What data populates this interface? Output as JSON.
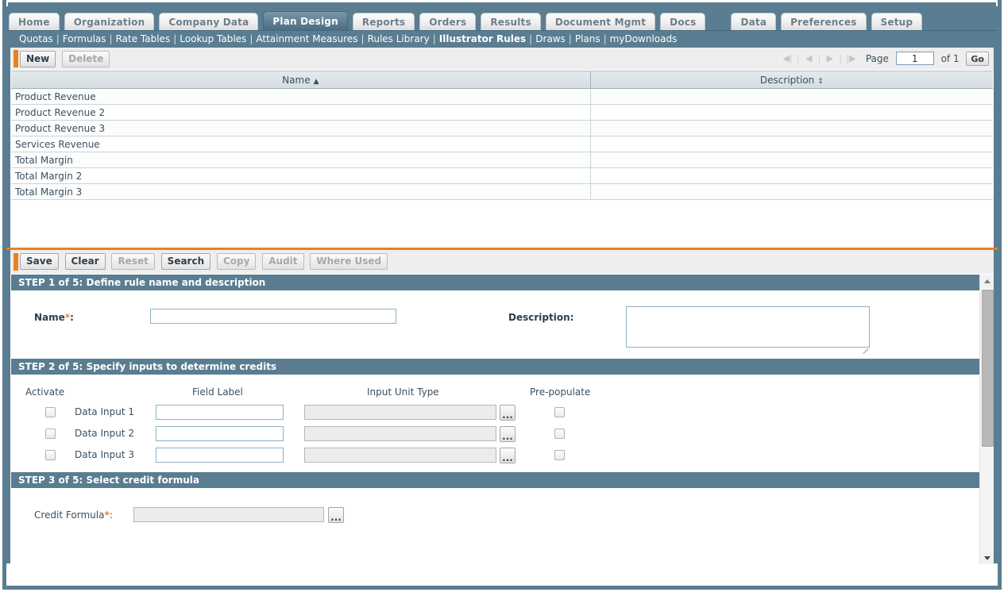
{
  "colors": {
    "frame": "#5a7d91",
    "accent_orange": "#e8811f",
    "step_header_bg": "#5a7d91",
    "active_tab_bg": "#5d7f93"
  },
  "tabs": [
    {
      "label": "Home",
      "active": false
    },
    {
      "label": "Organization",
      "active": false
    },
    {
      "label": "Company Data",
      "active": false
    },
    {
      "label": "Plan Design",
      "active": true
    },
    {
      "label": "Reports",
      "active": false
    },
    {
      "label": "Orders",
      "active": false
    },
    {
      "label": "Results",
      "active": false
    },
    {
      "label": "Document Mgmt",
      "active": false
    },
    {
      "label": "Docs",
      "active": false
    },
    {
      "label": "Data",
      "active": false
    },
    {
      "label": "Preferences",
      "active": false
    },
    {
      "label": "Setup",
      "active": false
    }
  ],
  "subnav": {
    "items": [
      {
        "label": "Quotas",
        "current": false
      },
      {
        "label": "Formulas",
        "current": false
      },
      {
        "label": "Rate Tables",
        "current": false
      },
      {
        "label": "Lookup Tables",
        "current": false
      },
      {
        "label": "Attainment Measures",
        "current": false
      },
      {
        "label": "Rules Library",
        "current": false
      },
      {
        "label": "Illustrator Rules",
        "current": true
      },
      {
        "label": "Draws",
        "current": false
      },
      {
        "label": "Plans",
        "current": false
      },
      {
        "label": "myDownloads",
        "current": false
      }
    ],
    "separator": "|"
  },
  "list_toolbar": {
    "new_label": "New",
    "delete_label": "Delete",
    "new_enabled": true,
    "delete_enabled": false
  },
  "pager": {
    "first_icon": "first-page-icon",
    "prev_icon": "prev-page-icon",
    "next_icon": "next-page-icon",
    "last_icon": "last-page-icon",
    "page_label": "Page",
    "page_value": "1",
    "of_label": "of 1",
    "go_label": "Go"
  },
  "grid": {
    "columns": [
      {
        "label": "Name",
        "sort": "asc",
        "sort_glyph": "▲"
      },
      {
        "label": "Description",
        "sort": "none",
        "sort_glyph": "↕"
      }
    ],
    "rows": [
      {
        "name": "Product Revenue",
        "description": ""
      },
      {
        "name": "Product Revenue 2",
        "description": ""
      },
      {
        "name": "Product Revenue 3",
        "description": ""
      },
      {
        "name": "Services Revenue",
        "description": ""
      },
      {
        "name": "Total Margin",
        "description": ""
      },
      {
        "name": "Total Margin 2",
        "description": ""
      },
      {
        "name": "Total Margin 3",
        "description": ""
      }
    ]
  },
  "form_toolbar": {
    "buttons": [
      {
        "label": "Save",
        "enabled": true
      },
      {
        "label": "Clear",
        "enabled": true
      },
      {
        "label": "Reset",
        "enabled": false
      },
      {
        "label": "Search",
        "enabled": true
      },
      {
        "label": "Copy",
        "enabled": false
      },
      {
        "label": "Audit",
        "enabled": false
      },
      {
        "label": "Where Used",
        "enabled": false
      }
    ]
  },
  "step1": {
    "header": "STEP 1 of 5: Define rule name and description",
    "name_label": "Name",
    "name_required": "*",
    "name_colon": ":",
    "name_value": "",
    "description_label": "Description",
    "description_colon": ":",
    "description_value": ""
  },
  "step2": {
    "header": "STEP 2 of 5: Specify inputs to determine credits",
    "col_activate": "Activate",
    "col_field_label": "Field Label",
    "col_input_unit_type": "Input Unit Type",
    "col_prepopulate": "Pre-populate",
    "ellipsis_label": "...",
    "rows": [
      {
        "label": "Data Input 1",
        "field_label_value": "",
        "unit_type_value": "",
        "activate_checked": false,
        "prepopulate_checked": false
      },
      {
        "label": "Data Input 2",
        "field_label_value": "",
        "unit_type_value": "",
        "activate_checked": false,
        "prepopulate_checked": false
      },
      {
        "label": "Data Input 3",
        "field_label_value": "",
        "unit_type_value": "",
        "activate_checked": false,
        "prepopulate_checked": false
      }
    ]
  },
  "step3": {
    "header": "STEP 3 of 5: Select credit formula",
    "credit_formula_label": "Credit Formula",
    "credit_formula_required": "*",
    "credit_formula_colon": ":",
    "credit_formula_value": "",
    "ellipsis_label": "..."
  }
}
